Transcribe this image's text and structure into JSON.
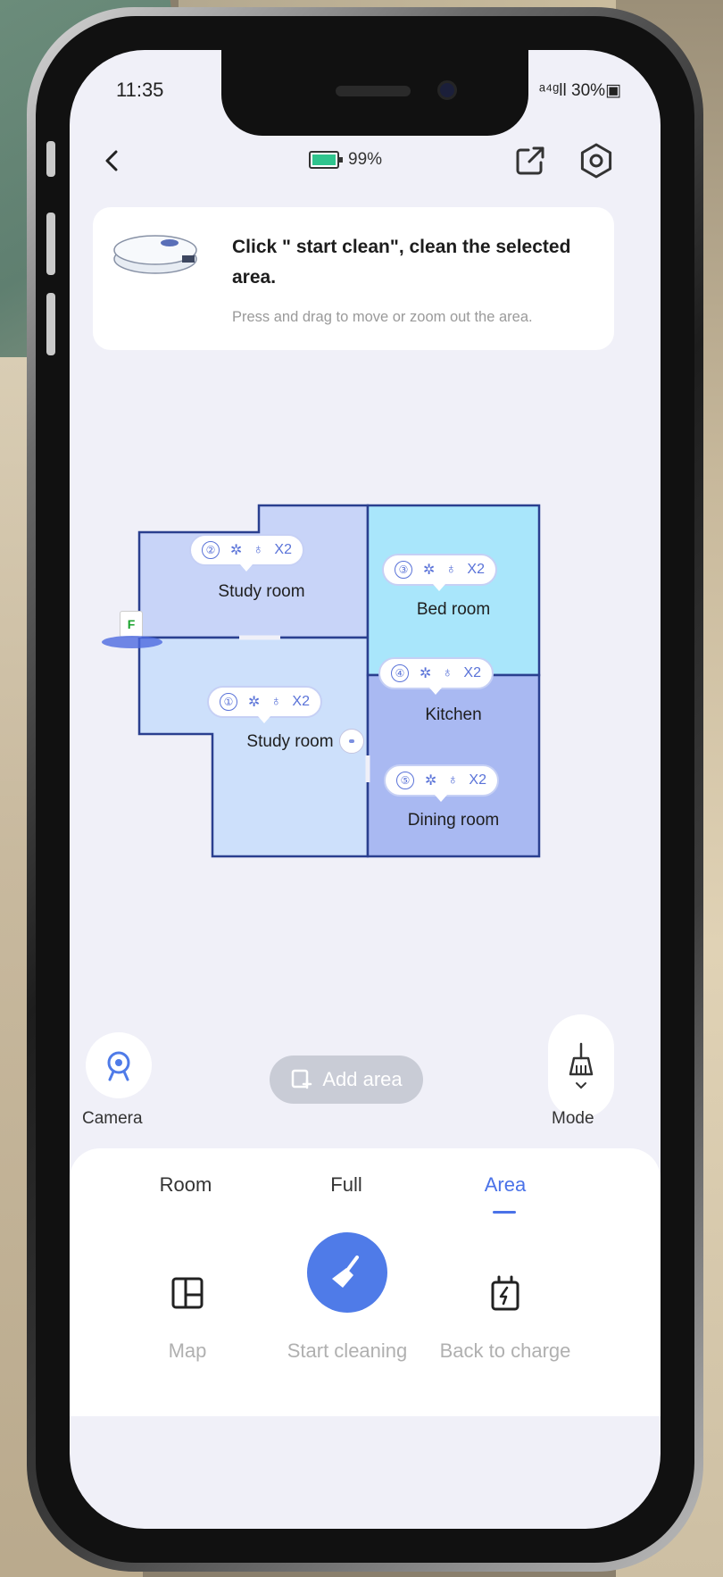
{
  "status_bar": {
    "time": "11:35",
    "right": "ᵃ⁴ᵍll 30%▣"
  },
  "top_bar": {
    "battery": "99%",
    "back_icon": "chevron-left-icon",
    "share_icon": "share-icon",
    "settings_icon": "gear-icon"
  },
  "hint": {
    "title": "Click \" start clean\", clean the selected area.",
    "subtitle": "Press and drag to move or zoom out the area."
  },
  "rooms": [
    {
      "number": "②",
      "label": "Study room",
      "repeat": "X2"
    },
    {
      "number": "③",
      "label": "Bed room",
      "repeat": "X2"
    },
    {
      "number": "①",
      "label": "Study room",
      "repeat": "X2"
    },
    {
      "number": "④",
      "label": "Kitchen",
      "repeat": "X2"
    },
    {
      "number": "⑤",
      "label": "Dining room",
      "repeat": "X2"
    }
  ],
  "dock_letter": "F",
  "controls": {
    "camera": "Camera",
    "add_area": "Add area",
    "mode": "Mode"
  },
  "tabs": [
    {
      "label": "Room",
      "active": false
    },
    {
      "label": "Full",
      "active": false
    },
    {
      "label": "Area",
      "active": true
    }
  ],
  "actions": {
    "map": "Map",
    "start": "Start cleaning",
    "charge": "Back to charge"
  },
  "colors": {
    "accent": "#4a72e8",
    "room_blue_light": "#c8d8fa",
    "room_cyan": "#a9e6fb",
    "room_blue_mid": "#a9b9f2",
    "map_border": "#2a3f8f",
    "battery_green": "#2fc48d"
  }
}
